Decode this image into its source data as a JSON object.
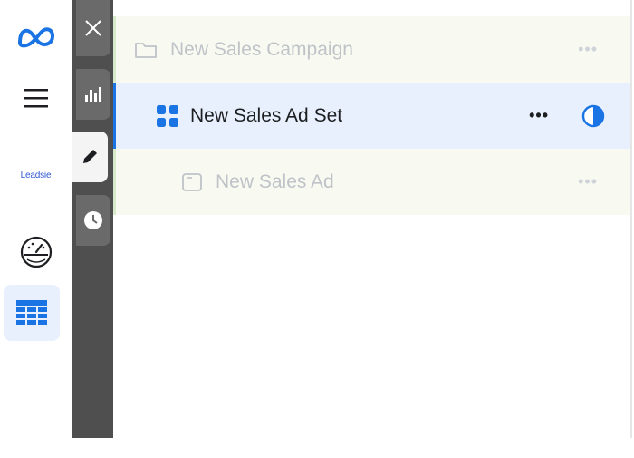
{
  "rail": {
    "items": [
      {
        "name": "meta-logo"
      },
      {
        "name": "menu"
      },
      {
        "name": "leadsie",
        "label": "Leadsie"
      },
      {
        "name": "dashboard"
      },
      {
        "name": "table-view",
        "active": true
      }
    ]
  },
  "tools": [
    {
      "name": "close"
    },
    {
      "name": "charts"
    },
    {
      "name": "edit",
      "active": true
    },
    {
      "name": "history"
    }
  ],
  "tree": {
    "campaign": {
      "label": "New Sales Campaign",
      "more": "•••"
    },
    "adset": {
      "label": "New Sales Ad Set",
      "more": "•••"
    },
    "ad": {
      "label": "New Sales Ad",
      "more": "•••"
    }
  },
  "colors": {
    "accent": "#1b74e4",
    "selected_row": "#e7f0fc",
    "strip": "#4f4f4f",
    "muted_row": "#f8faf2"
  }
}
